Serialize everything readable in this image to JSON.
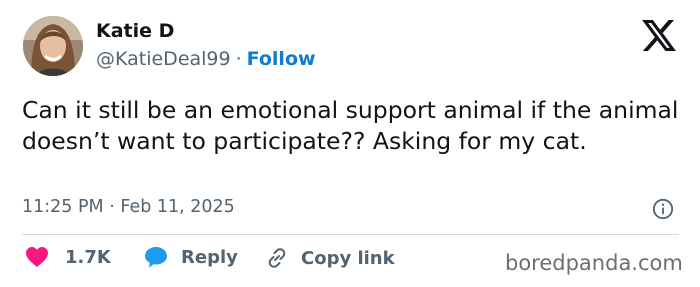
{
  "author": {
    "name": "Katie D",
    "handle": "@KatieDeal99",
    "separator": "·",
    "follow_label": "Follow"
  },
  "tweet": {
    "text": "Can it still be an emotional support animal if the animal doesn’t want to participate?? Asking for my cat.",
    "timestamp": "11:25 PM · Feb 11, 2025"
  },
  "actions": {
    "like_count": "1.7K",
    "reply_label": "Reply",
    "copy_link_label": "Copy link"
  },
  "watermark": "boredpanda.com",
  "colors": {
    "follow_blue": "#0f7ecf",
    "like_pink": "#f91880",
    "reply_blue": "#1d9bf0",
    "muted_text": "#536471",
    "divider": "#cfd9de"
  },
  "icons": [
    "x-logo-icon",
    "info-icon",
    "heart-icon",
    "reply-bubble-icon",
    "link-icon"
  ]
}
